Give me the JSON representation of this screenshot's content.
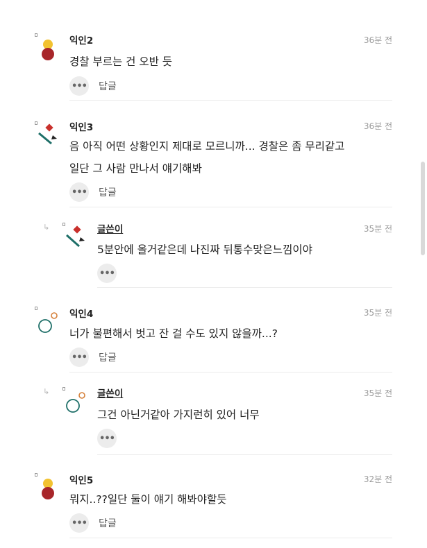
{
  "comments": [
    {
      "author": "익인2",
      "time": "36분 전",
      "lines": [
        "경찰 부르는 건 오반 듯"
      ],
      "reply_label": "답글"
    },
    {
      "author": "익인3",
      "time": "36분 전",
      "lines": [
        "음 아직 어떤 상황인지 제대로 모르니까... 경찰은 좀 무리같고",
        "일단 그 사람 만나서 얘기해봐"
      ],
      "reply_label": "답글"
    },
    {
      "author": "글쓴이",
      "time": "35분 전",
      "lines": [
        "5분안에 올거같은데 나진짜 뒤통수맞은느낌이야"
      ]
    },
    {
      "author": "익인4",
      "time": "35분 전",
      "lines": [
        "너가 불편해서 벗고 잔 걸 수도 있지 않을까...?"
      ],
      "reply_label": "답글"
    },
    {
      "author": "글쓴이",
      "time": "35분 전",
      "lines": [
        "그건 아닌거같아 가지런히 있어 너무"
      ]
    },
    {
      "author": "익인5",
      "time": "32분 전",
      "lines": [
        "뭐지..??일단 둘이 얘기 해봐야할듯"
      ],
      "reply_label": "답글"
    }
  ],
  "ui": {
    "more_glyph": "•••",
    "reply_arrow_glyph": "↳"
  },
  "colors": {
    "avatar_yellow": "#f2c230",
    "avatar_red": "#a8262a",
    "avatar_teal": "#1e6f68",
    "avatar_orange": "#d6803a",
    "divider": "#ececec"
  }
}
